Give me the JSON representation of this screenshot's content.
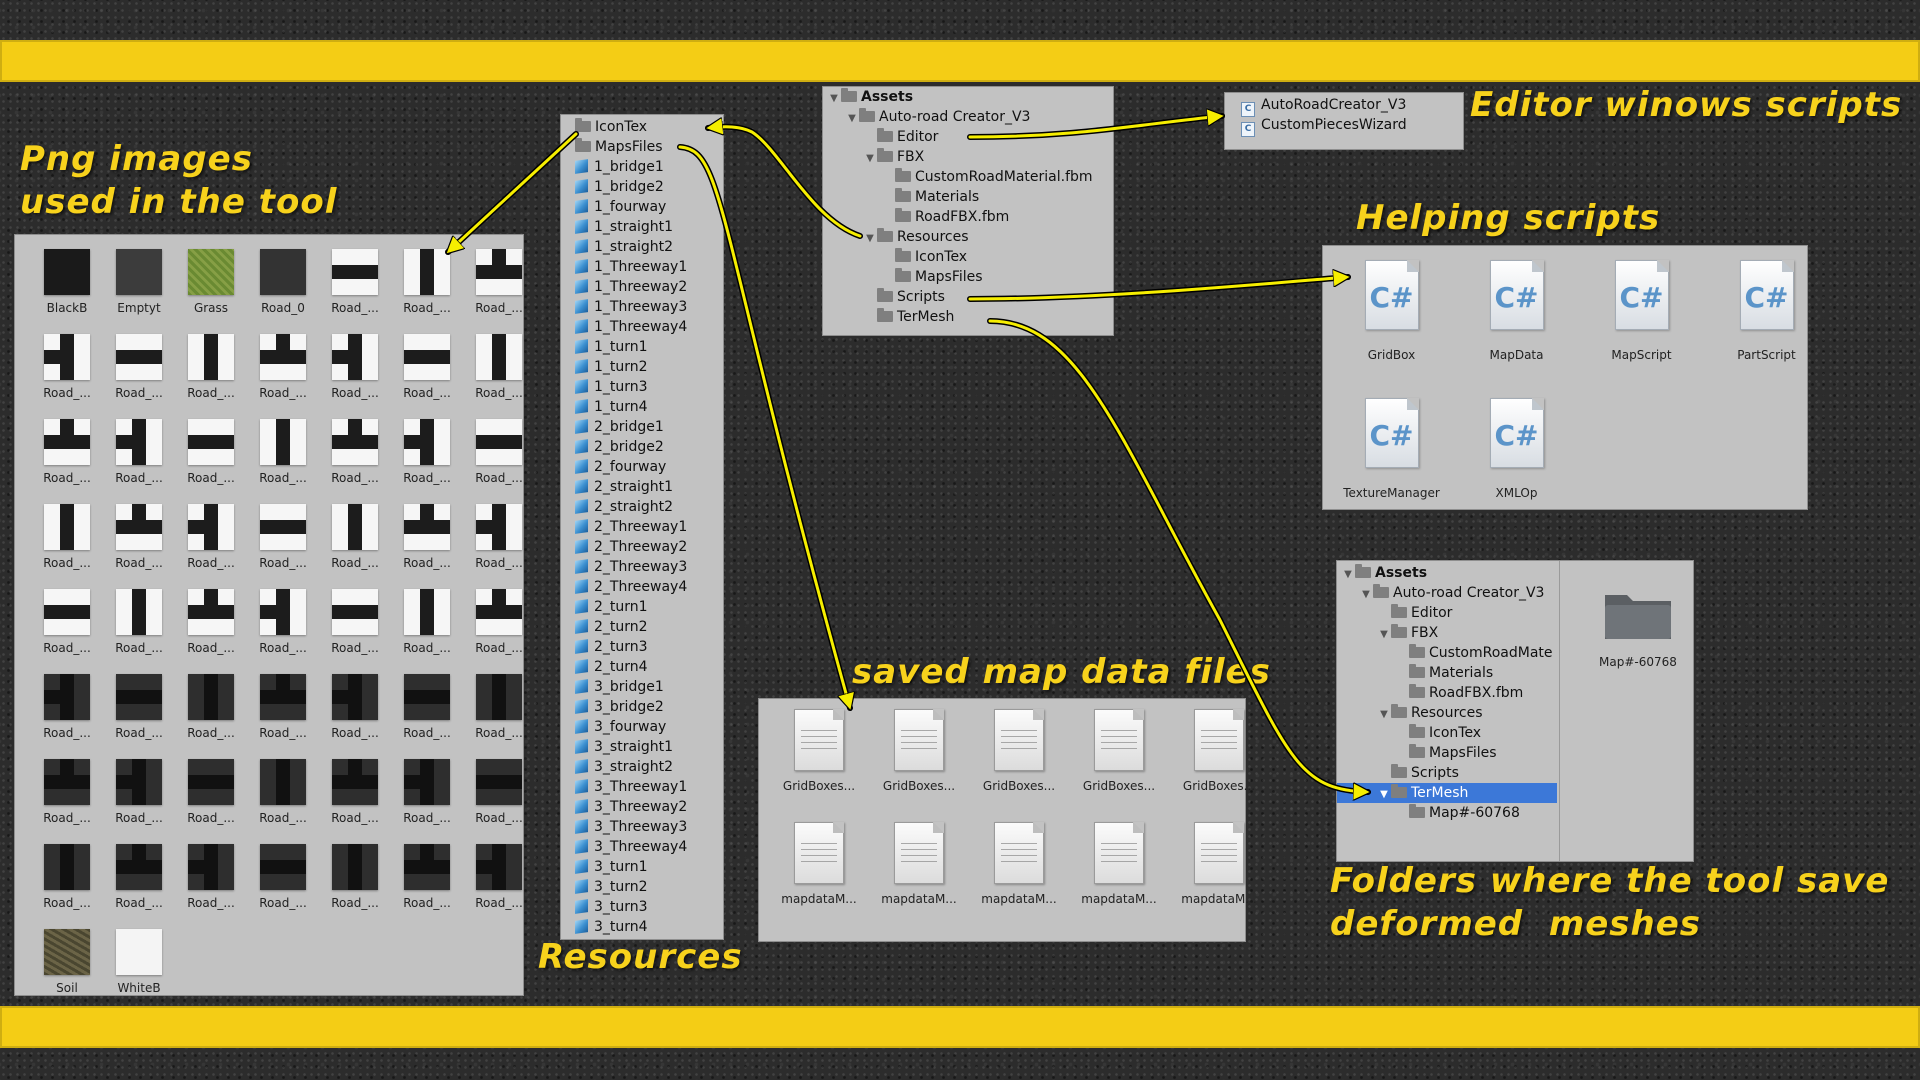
{
  "headings": {
    "png": "Png images\nused in the tool",
    "resources": "Resources",
    "editor": "Editor winows scripts",
    "helping": "Helping scripts",
    "saved": "saved map data files",
    "folders": "Folders where the tool save\ndeformed  meshes"
  },
  "textures": [
    "BlackB",
    "Emptyt",
    "Grass",
    "Road_0",
    "Road_...",
    "Road_...",
    "Road_...",
    "Road_...",
    "Road_...",
    "Road_...",
    "Road_...",
    "Road_...",
    "Road_...",
    "Road_...",
    "Road_...",
    "Road_...",
    "Road_...",
    "Road_...",
    "Road_...",
    "Road_...",
    "Road_...",
    "Road_...",
    "Road_...",
    "Road_...",
    "Road_...",
    "Road_...",
    "Road_...",
    "Road_...",
    "Road_...",
    "Road_...",
    "Road_...",
    "Road_...",
    "Road_...",
    "Road_...",
    "Road_...",
    "Road_...",
    "Road_...",
    "Road_...",
    "Road_...",
    "Road_...",
    "Road_...",
    "Road_...",
    "Road_...",
    "Road_...",
    "Road_...",
    "Road_...",
    "Road_...",
    "Road_...",
    "Road_...",
    "Road_...",
    "Road_...",
    "Road_...",
    "Road_...",
    "Road_...",
    "Road_...",
    "Road_...",
    "Soil",
    "WhiteB"
  ],
  "resources_list": {
    "folders": [
      "IconTex",
      "MapsFiles"
    ],
    "items": [
      "1_bridge1",
      "1_bridge2",
      "1_fourway",
      "1_straight1",
      "1_straight2",
      "1_Threeway1",
      "1_Threeway2",
      "1_Threeway3",
      "1_Threeway4",
      "1_turn1",
      "1_turn2",
      "1_turn3",
      "1_turn4",
      "2_bridge1",
      "2_bridge2",
      "2_fourway",
      "2_straight1",
      "2_straight2",
      "2_Threeway1",
      "2_Threeway2",
      "2_Threeway3",
      "2_Threeway4",
      "2_turn1",
      "2_turn2",
      "2_turn3",
      "2_turn4",
      "3_bridge1",
      "3_bridge2",
      "3_fourway",
      "3_straight1",
      "3_straight2",
      "3_Threeway1",
      "3_Threeway2",
      "3_Threeway3",
      "3_Threeway4",
      "3_turn1",
      "3_turn2",
      "3_turn3",
      "3_turn4"
    ]
  },
  "assets_tree": [
    "Assets",
    "Auto-road Creator_V3",
    "Editor",
    "FBX",
    "CustomRoadMaterial.fbm",
    "Materials",
    "RoadFBX.fbm",
    "Resources",
    "IconTex",
    "MapsFiles",
    "Scripts",
    "TerMesh"
  ],
  "editor_scripts": [
    "AutoRoadCreator_V3",
    "CustomPiecesWizard"
  ],
  "helping_scripts": [
    "GridBox",
    "MapData",
    "MapScript",
    "PartScript",
    "TextureManager",
    "XMLOp"
  ],
  "map_files": [
    "GridBoxes...",
    "GridBoxes...",
    "GridBoxes...",
    "GridBoxes...",
    "GridBoxes...",
    "mapdataM...",
    "mapdataM...",
    "mapdataM...",
    "mapdataM...",
    "mapdataM..."
  ],
  "termesh_tree": [
    "Assets",
    "Auto-road Creator_V3",
    "Editor",
    "FBX",
    "CustomRoadMate",
    "Materials",
    "RoadFBX.fbm",
    "Resources",
    "IconTex",
    "MapsFiles",
    "Scripts",
    "TerMesh",
    "Map#-60768"
  ],
  "termesh_folder_label": "Map#-60768",
  "colors": {
    "accent": "#f4cd15",
    "panel": "#c2c2c2",
    "selection": "#3c78d8"
  }
}
